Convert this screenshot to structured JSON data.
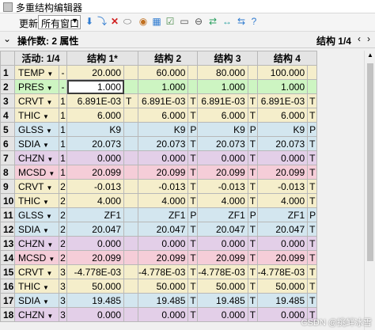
{
  "window": {
    "title": "多重结构编辑器"
  },
  "toolbar": {
    "update_label": "更新:",
    "update_value": "所有窗口",
    "icons": [
      "insert-operand-icon",
      "insert-config-icon",
      "delete-icon",
      "ellipse-icon",
      "stop-icon",
      "table-icon",
      "check-icon",
      "toggle-icon",
      "convert-icon",
      "arrows-icon",
      "settings-icon",
      "help-icon"
    ]
  },
  "opbar": {
    "label": "操作数: 2 属性",
    "config": "结构 1/4"
  },
  "table": {
    "headers": [
      "活动: 1/4",
      "结构 1*",
      "结构 2",
      "结构 3",
      "结构 4"
    ],
    "rows": [
      {
        "n": "1",
        "op": "TEMP",
        "dd": "▼",
        "num": "-",
        "v": [
          "20.000",
          "",
          "60.000",
          "",
          "80.000",
          "",
          "100.000",
          ""
        ],
        "color": "#f5eecb"
      },
      {
        "n": "2",
        "op": "PRES",
        "dd": "▼",
        "num": "-",
        "v": [
          "1.000",
          "",
          "1.000",
          "",
          "1.000",
          "",
          "1.000",
          ""
        ],
        "color": "#cdf5c2"
      },
      {
        "n": "3",
        "op": "CRVT",
        "dd": "▼",
        "num": "1",
        "v": [
          "6.891E-03",
          "T",
          "6.891E-03",
          "T",
          "6.891E-03",
          "T",
          "6.891E-03",
          "T"
        ],
        "color": "#f5eecb"
      },
      {
        "n": "4",
        "op": "THIC",
        "dd": "▼",
        "num": "1",
        "v": [
          "6.000",
          "",
          "6.000",
          "T",
          "6.000",
          "T",
          "6.000",
          "T"
        ],
        "color": "#f5eecb"
      },
      {
        "n": "5",
        "op": "GLSS",
        "dd": "▼",
        "num": "1",
        "v": [
          "K9",
          "",
          "K9",
          "P",
          "K9",
          "P",
          "K9",
          "P"
        ],
        "color": "#d3e6ef"
      },
      {
        "n": "6",
        "op": "SDIA",
        "dd": "▼",
        "num": "1",
        "v": [
          "20.073",
          "",
          "20.073",
          "T",
          "20.073",
          "T",
          "20.073",
          "T"
        ],
        "color": "#d3e6ef"
      },
      {
        "n": "7",
        "op": "CHZN",
        "dd": "▼",
        "num": "1",
        "v": [
          "0.000",
          "",
          "0.000",
          "T",
          "0.000",
          "T",
          "0.000",
          "T"
        ],
        "color": "#e3cfe8"
      },
      {
        "n": "8",
        "op": "MCSD",
        "dd": "▼",
        "num": "1",
        "v": [
          "20.099",
          "",
          "20.099",
          "T",
          "20.099",
          "T",
          "20.099",
          "T"
        ],
        "color": "#f5cdd8"
      },
      {
        "n": "9",
        "op": "CRVT",
        "dd": "▼",
        "num": "2",
        "v": [
          "-0.013",
          "",
          "-0.013",
          "T",
          "-0.013",
          "T",
          "-0.013",
          "T"
        ],
        "color": "#f5eecb"
      },
      {
        "n": "10",
        "op": "THIC",
        "dd": "▼",
        "num": "2",
        "v": [
          "4.000",
          "",
          "4.000",
          "T",
          "4.000",
          "T",
          "4.000",
          "T"
        ],
        "color": "#f5eecb"
      },
      {
        "n": "11",
        "op": "GLSS",
        "dd": "▼",
        "num": "2",
        "v": [
          "ZF1",
          "",
          "ZF1",
          "P",
          "ZF1",
          "P",
          "ZF1",
          "P"
        ],
        "color": "#d3e6ef"
      },
      {
        "n": "12",
        "op": "SDIA",
        "dd": "▼",
        "num": "2",
        "v": [
          "20.047",
          "",
          "20.047",
          "T",
          "20.047",
          "T",
          "20.047",
          "T"
        ],
        "color": "#d3e6ef"
      },
      {
        "n": "13",
        "op": "CHZN",
        "dd": "▼",
        "num": "2",
        "v": [
          "0.000",
          "",
          "0.000",
          "T",
          "0.000",
          "T",
          "0.000",
          "T"
        ],
        "color": "#e3cfe8"
      },
      {
        "n": "14",
        "op": "MCSD",
        "dd": "▼",
        "num": "2",
        "v": [
          "20.099",
          "",
          "20.099",
          "T",
          "20.099",
          "T",
          "20.099",
          "T"
        ],
        "color": "#f5cdd8"
      },
      {
        "n": "15",
        "op": "CRVT",
        "dd": "▼",
        "num": "3",
        "v": [
          "-4.778E-03",
          "",
          "-4.778E-03",
          "T",
          "-4.778E-03",
          "T",
          "-4.778E-03",
          "T"
        ],
        "color": "#f5eecb"
      },
      {
        "n": "16",
        "op": "THIC",
        "dd": "▼",
        "num": "3",
        "v": [
          "50.000",
          "",
          "50.000",
          "T",
          "50.000",
          "T",
          "50.000",
          "T"
        ],
        "color": "#f5eecb"
      },
      {
        "n": "17",
        "op": "SDIA",
        "dd": "▼",
        "num": "3",
        "v": [
          "19.485",
          "",
          "19.485",
          "T",
          "19.485",
          "T",
          "19.485",
          "T"
        ],
        "color": "#d3e6ef"
      },
      {
        "n": "18",
        "op": "CHZN",
        "dd": "▼",
        "num": "3",
        "v": [
          "0.000",
          "",
          "0.000",
          "T",
          "0.000",
          "T",
          "0.000",
          "T"
        ],
        "color": "#e3cfe8"
      }
    ]
  },
  "watermark": "CSDN @挑衅冰雪"
}
